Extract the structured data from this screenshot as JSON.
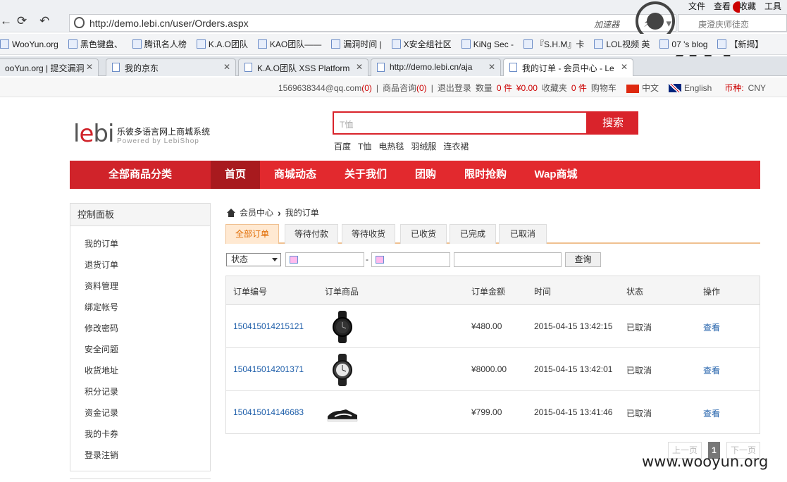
{
  "browser": {
    "menu": [
      "文件",
      "查看",
      "收藏",
      "工具"
    ],
    "url": "http://demo.lebi.cn/user/Orders.aspx",
    "accelerator": "加速器",
    "search_placeholder": "庚澄庆师徒恋",
    "bookmarks": [
      "WooYun.org",
      "黑色键盘、",
      "腾讯名人榜",
      "K.A.O团队",
      "KAO团队——",
      "漏洞时间 |",
      "X安全组社区",
      "KiNg Sec -",
      "『S.H.M』卡",
      "LOL视频 英",
      "07 's blog",
      "【新揭】"
    ],
    "tabs": [
      {
        "label": "ooYun.org | 提交漏洞",
        "active": false
      },
      {
        "label": "我的京东",
        "active": false
      },
      {
        "label": "K.A.O团队 XSS Platform",
        "active": false
      },
      {
        "label": "http://demo.lebi.cn/aja",
        "active": false
      },
      {
        "label": "我的订单 - 会员中心 - Le",
        "active": true
      }
    ]
  },
  "topbar": {
    "email": "1569638344@qq.com",
    "email_count": "(0)",
    "consult": "商品咨询",
    "consult_count": "(0)",
    "logout": "退出登录",
    "qty_label": "数量",
    "qty_value": "0 件",
    "amount": "¥0.00",
    "fav_label": "收藏夹",
    "fav_value": "0 件",
    "cart": "购物车",
    "lang_zh": "中文",
    "lang_en": "English",
    "currency_label": "币种:",
    "currency_value": "CNY"
  },
  "header": {
    "logo_text_a": "l",
    "logo_text_b": "e",
    "logo_text_c": "bi",
    "site_name": "乐彼多语言网上商城系统",
    "site_sub": "Powered by LebiShop",
    "search_placeholder": "T恤",
    "search_button": "搜索",
    "hotwords": [
      "百度",
      "T恤",
      "电热毯",
      "羽绒服",
      "连衣裙"
    ]
  },
  "nav": {
    "all_categories": "全部商品分类",
    "items": [
      "首页",
      "商城动态",
      "关于我们",
      "团购",
      "限时抢购",
      "Wap商城"
    ]
  },
  "sidebar": {
    "title": "控制面板",
    "items": [
      "我的订单",
      "退货订单",
      "资料管理",
      "绑定帐号",
      "修改密码",
      "安全问题",
      "收货地址",
      "积分记录",
      "资金记录",
      "我的卡券",
      "登录注销"
    ]
  },
  "breadcrumb": {
    "home": "会员中心",
    "current": "我的订单"
  },
  "order_tabs": [
    "全部订单",
    "等待付款",
    "等待收货",
    "已收货",
    "已完成",
    "已取消"
  ],
  "filter": {
    "status_selected": "状态",
    "date_separator": "-",
    "query_button": "查询"
  },
  "table": {
    "headers": [
      "订单编号",
      "订单商品",
      "订单金额",
      "时间",
      "状态",
      "操作"
    ],
    "rows": [
      {
        "id": "150415014215121",
        "product": "watch-black",
        "amount": "¥480.00",
        "time": "2015-04-15 13:42:15",
        "status": "已取消",
        "action": "查看"
      },
      {
        "id": "150415014201371",
        "product": "watch-silver",
        "amount": "¥8000.00",
        "time": "2015-04-15 13:42:01",
        "status": "已取消",
        "action": "查看"
      },
      {
        "id": "150415014146683",
        "product": "sneaker",
        "amount": "¥799.00",
        "time": "2015-04-15 13:41:46",
        "status": "已取消",
        "action": "查看"
      }
    ]
  },
  "pager": {
    "prev": "上一页",
    "current": "1",
    "next": "下一页"
  },
  "watermark": "www.wooyun.org",
  "colors": {
    "brand_red": "#d9232b",
    "nav_active": "#a81a1e",
    "link_blue": "#1f5faa",
    "tab_active_orange": "#e06a00"
  }
}
